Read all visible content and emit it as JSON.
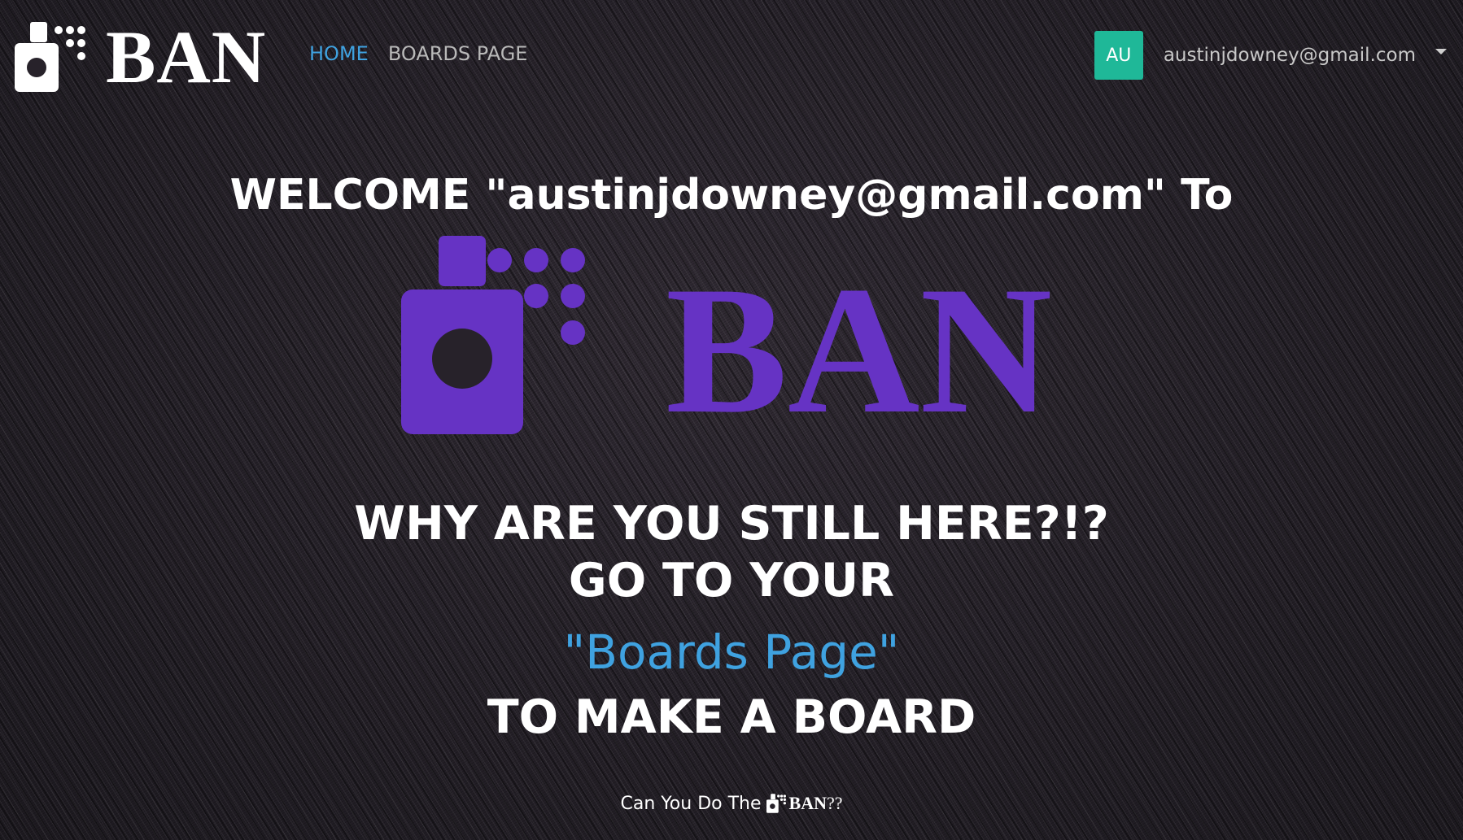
{
  "brand": {
    "name": "BAN",
    "icon": "spray-bottle-icon"
  },
  "colors": {
    "accent_blue": "#3fa2e0",
    "logo_purple": "#6633c4",
    "avatar_teal": "#1fb898"
  },
  "nav": {
    "links": [
      {
        "label": "HOME",
        "active": true
      },
      {
        "label": "BOARDS PAGE",
        "active": false
      }
    ]
  },
  "user": {
    "initials": "AU",
    "email": "austinjdowney@gmail.com",
    "dropdown_icon": "caret-down-icon"
  },
  "hero": {
    "welcome": "WELCOME \"austinjdowney@gmail.com\" To",
    "logo_text": "BAN",
    "line1": "WHY ARE YOU STILL HERE?!?",
    "line2": "GO TO YOUR",
    "boards_link": "\"Boards Page\"",
    "line3": "TO MAKE A BOARD"
  },
  "footer": {
    "prefix": "Can You Do The",
    "brand": "BAN",
    "suffix": "??"
  }
}
